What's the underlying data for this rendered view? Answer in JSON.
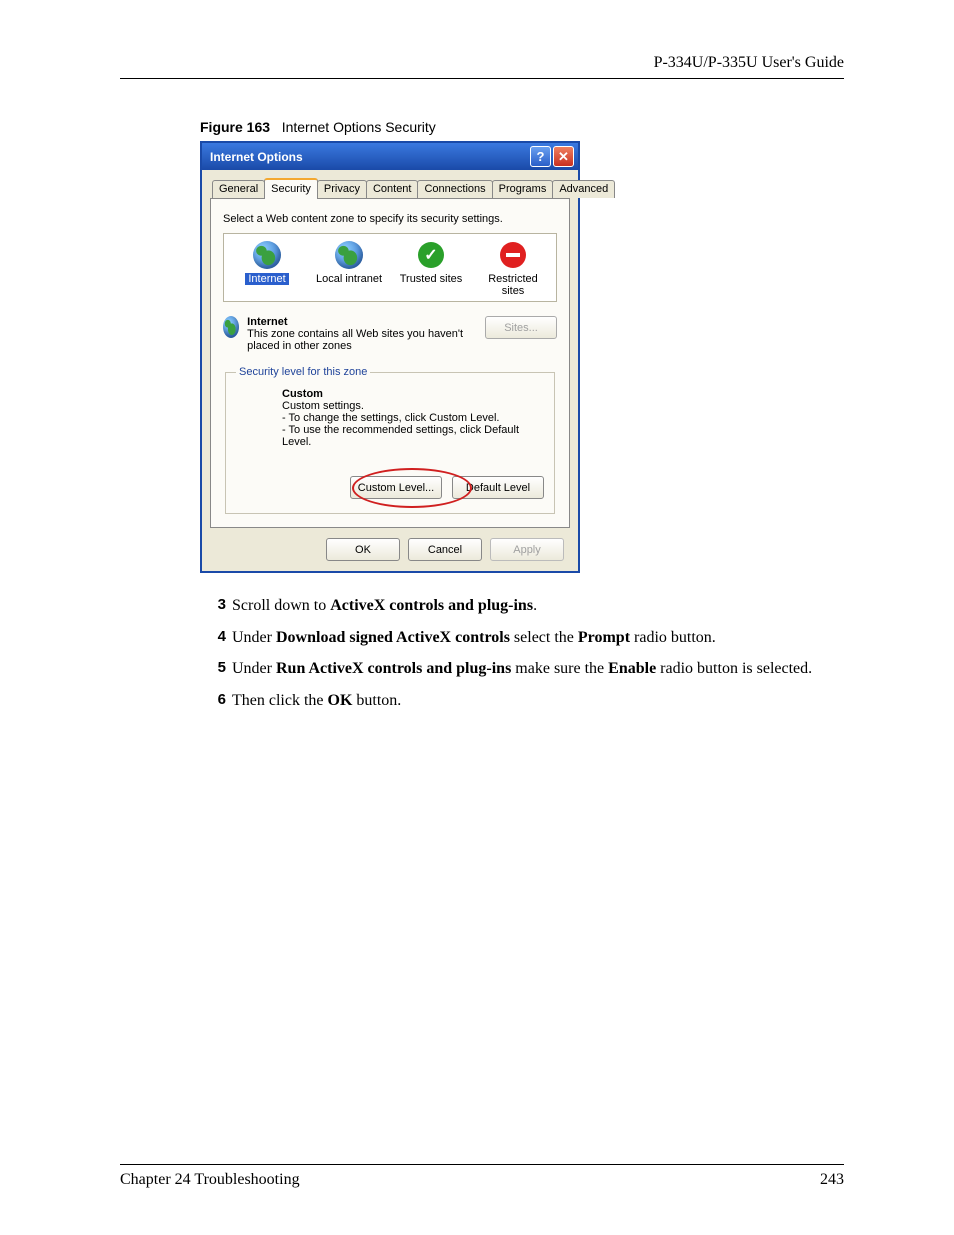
{
  "header": {
    "right": "P-334U/P-335U User's Guide"
  },
  "figure": {
    "label": "Figure 163",
    "title": "Internet Options Security"
  },
  "dialog": {
    "title": "Internet Options",
    "tabs": [
      "General",
      "Security",
      "Privacy",
      "Content",
      "Connections",
      "Programs",
      "Advanced"
    ],
    "active_tab_index": 1,
    "zone_prompt": "Select a Web content zone to specify its security settings.",
    "zones": [
      {
        "label": "Internet",
        "icon": "globe",
        "selected": true
      },
      {
        "label": "Local intranet",
        "icon": "globe",
        "selected": false
      },
      {
        "label": "Trusted sites",
        "icon": "shield",
        "selected": false
      },
      {
        "label": "Restricted sites",
        "icon": "noentry",
        "selected": false
      }
    ],
    "zone_info": {
      "heading": "Internet",
      "desc": "This zone contains all Web sites you haven't placed in other zones",
      "sites_btn": "Sites..."
    },
    "security_group": {
      "legend": "Security level for this zone",
      "heading": "Custom",
      "line1": "Custom settings.",
      "line2": "- To change the settings, click Custom Level.",
      "line3": "- To use the recommended settings, click Default Level.",
      "custom_btn": "Custom Level...",
      "default_btn": "Default Level"
    },
    "buttons": {
      "ok": "OK",
      "cancel": "Cancel",
      "apply": "Apply"
    }
  },
  "steps": [
    {
      "n": "3",
      "pre": "Scroll down to ",
      "b1": "ActiveX controls and plug-ins",
      "post": "."
    },
    {
      "n": "4",
      "pre": "Under ",
      "b1": "Download signed ActiveX controls",
      "mid": " select the ",
      "b2": "Prompt",
      "post": " radio button."
    },
    {
      "n": "5",
      "pre": "Under ",
      "b1": "Run ActiveX controls and plug-ins",
      "mid": " make sure the ",
      "b2": "Enable",
      "post": " radio button is selected."
    },
    {
      "n": "6",
      "pre": "Then click the ",
      "b1": "OK",
      "post": " button."
    }
  ],
  "footer": {
    "left": "Chapter 24 Troubleshooting",
    "right": "243"
  }
}
